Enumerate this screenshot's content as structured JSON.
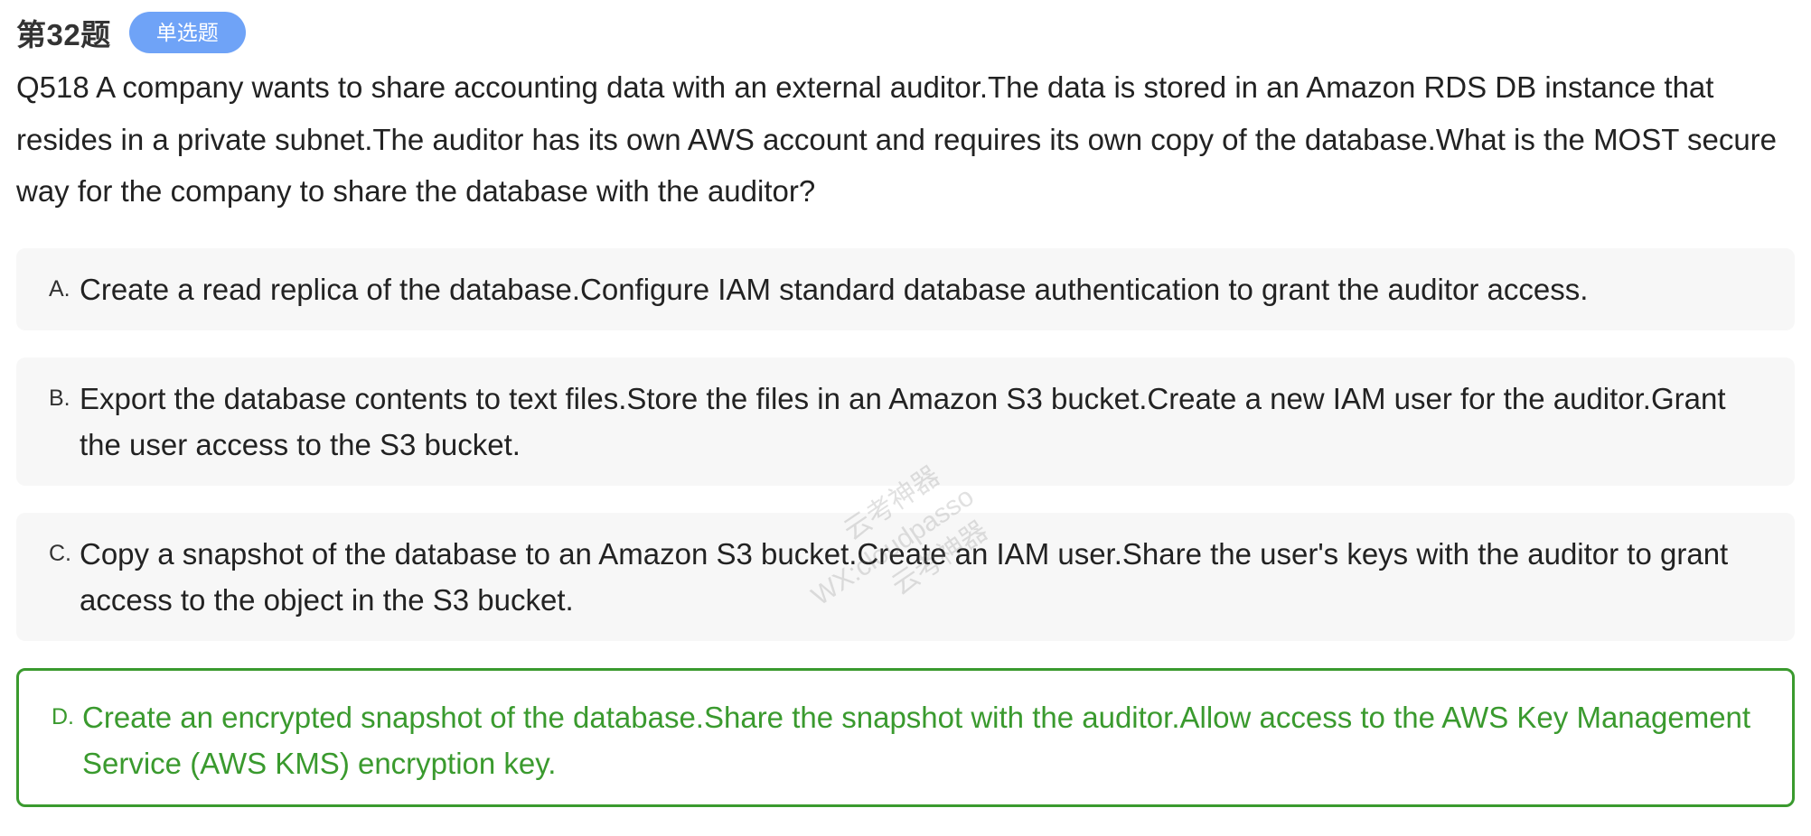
{
  "header": {
    "question_number": "第32题",
    "type_badge": "单选题"
  },
  "question": {
    "text": "Q518 A company wants to share accounting data with an external auditor.The data is stored in an Amazon RDS DB instance that resides in a private subnet.The auditor has its own AWS account and requires its own copy of the database.What is the MOST secure way for the company to share the database with the auditor?"
  },
  "options": [
    {
      "letter": "A.",
      "text": "Create a read replica of the database.Configure IAM standard database authentication to grant the auditor access."
    },
    {
      "letter": "B.",
      "text": "Export the database contents to text files.Store the files in an Amazon S3 bucket.Create a new IAM user for the auditor.Grant the user access to the S3 bucket."
    },
    {
      "letter": "C.",
      "text": "Copy a snapshot of the database to an Amazon S3 bucket.Create an IAM user.Share the user's keys with the auditor to grant access to the object in the S3 bucket."
    },
    {
      "letter": "D.",
      "text": "Create an encrypted snapshot of the database.Share the snapshot with the auditor.Allow access to the AWS Key Management Service (AWS KMS) encryption key.",
      "correct": true
    }
  ],
  "watermark": {
    "line1": "云考神器",
    "line2": "WX:cloudpasso",
    "line3": "云考神器"
  },
  "colors": {
    "badge": "#6fa3f7",
    "correct": "#3a9a2e",
    "option_bg": "#f7f7f7"
  }
}
